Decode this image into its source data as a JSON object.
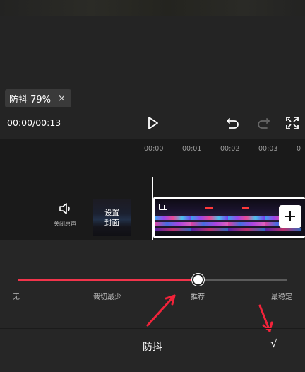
{
  "toast": {
    "text": "防抖 79%",
    "close": "×"
  },
  "player": {
    "time": "00:00/00:13"
  },
  "ruler": [
    "00:00",
    "00:01",
    "00:02",
    "00:03",
    "0"
  ],
  "track": {
    "mute_label": "关闭原声",
    "cover_line1": "设置",
    "cover_line2": "封面"
  },
  "stabilize": {
    "options": [
      "无",
      "裁切最少",
      "推荐",
      "最稳定"
    ],
    "value_fraction": 0.67,
    "accent": "#f2344b"
  },
  "footer": {
    "title": "防抖",
    "confirm": "√"
  },
  "icons": [
    "play-icon",
    "undo-icon",
    "redo-icon",
    "fullscreen-icon",
    "speaker-icon",
    "plus-icon",
    "clip-icon",
    "close-icon"
  ]
}
